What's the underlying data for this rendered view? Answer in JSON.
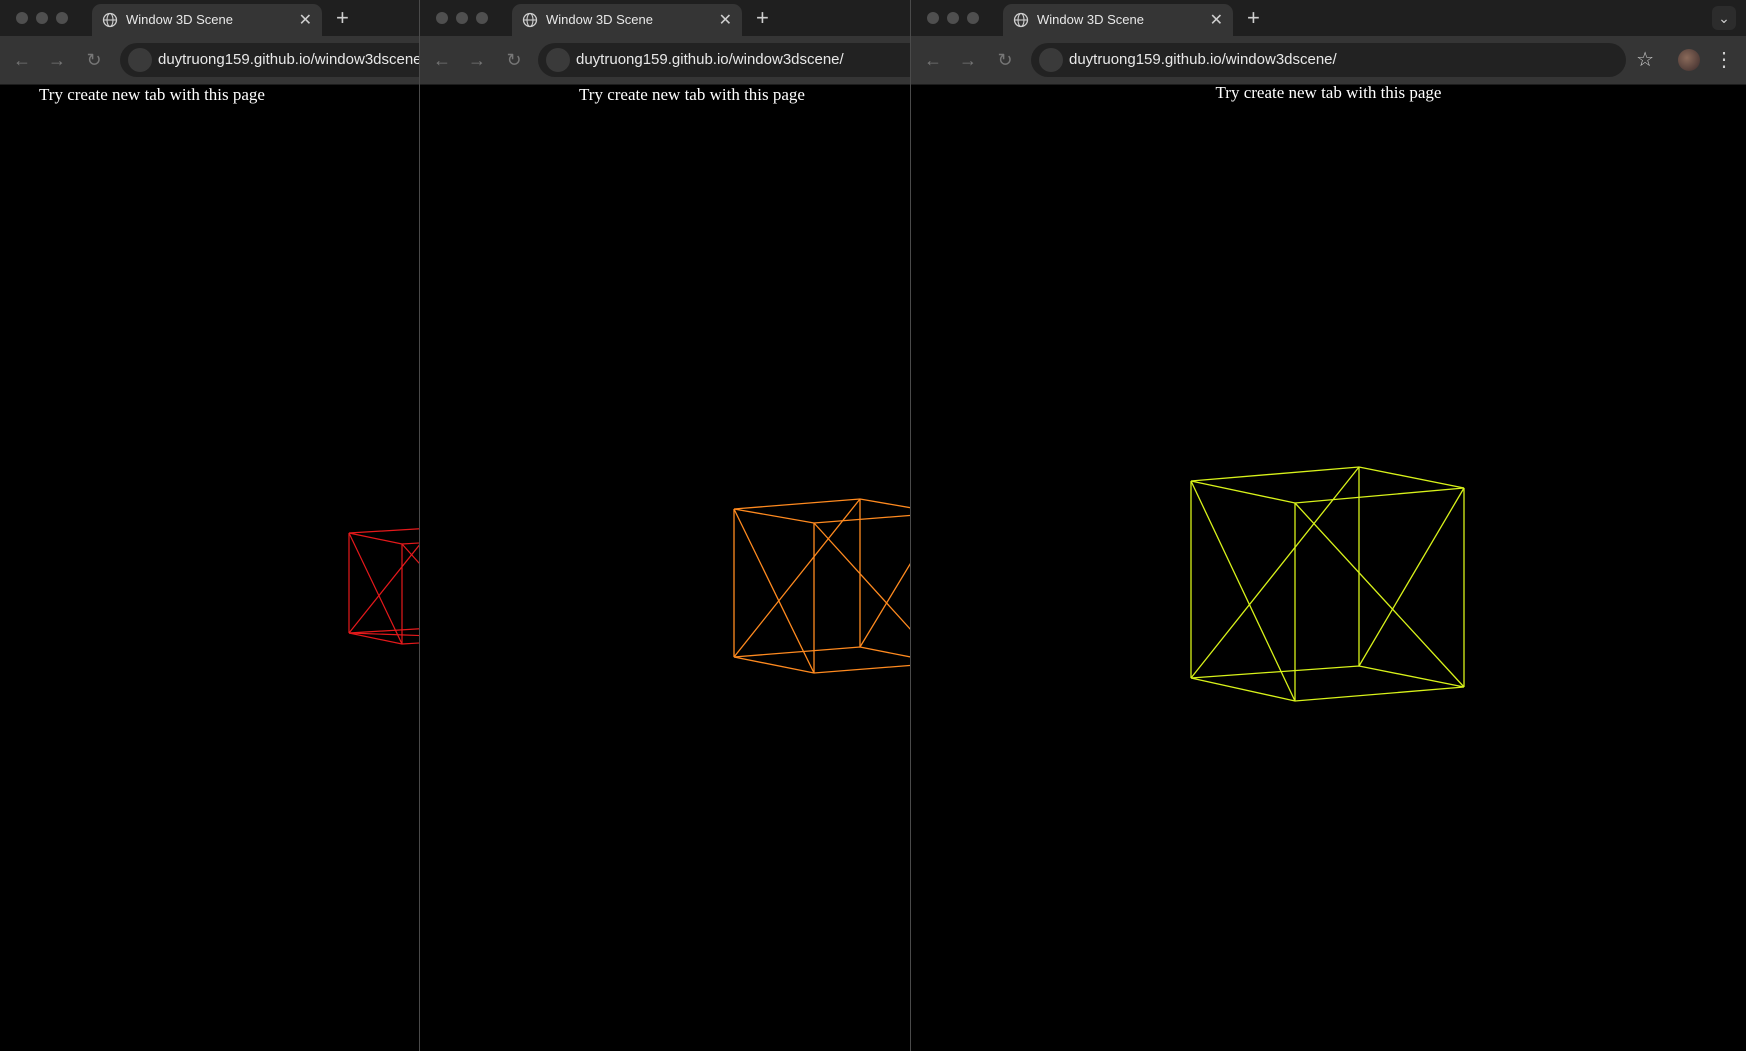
{
  "tab_title": "Window 3D Scene",
  "tab_close_glyph": "✕",
  "new_tab_glyph": "+",
  "dropdown_glyph": "⌄",
  "nav": {
    "back": "←",
    "forward": "→",
    "reload": "↻"
  },
  "url": "duytruong159.github.io/window3dscene/",
  "page_message": "Try create new tab with this page",
  "toolbar": {
    "bookmark_icon": "star-icon",
    "profile_icon": "avatar-icon",
    "menu_glyph": "⋮"
  },
  "cubes": {
    "window_1": {
      "color": "#e5191b"
    },
    "window_2": {
      "color": "#ff8a1f"
    },
    "window_3": {
      "color": "#d8f21a"
    }
  }
}
